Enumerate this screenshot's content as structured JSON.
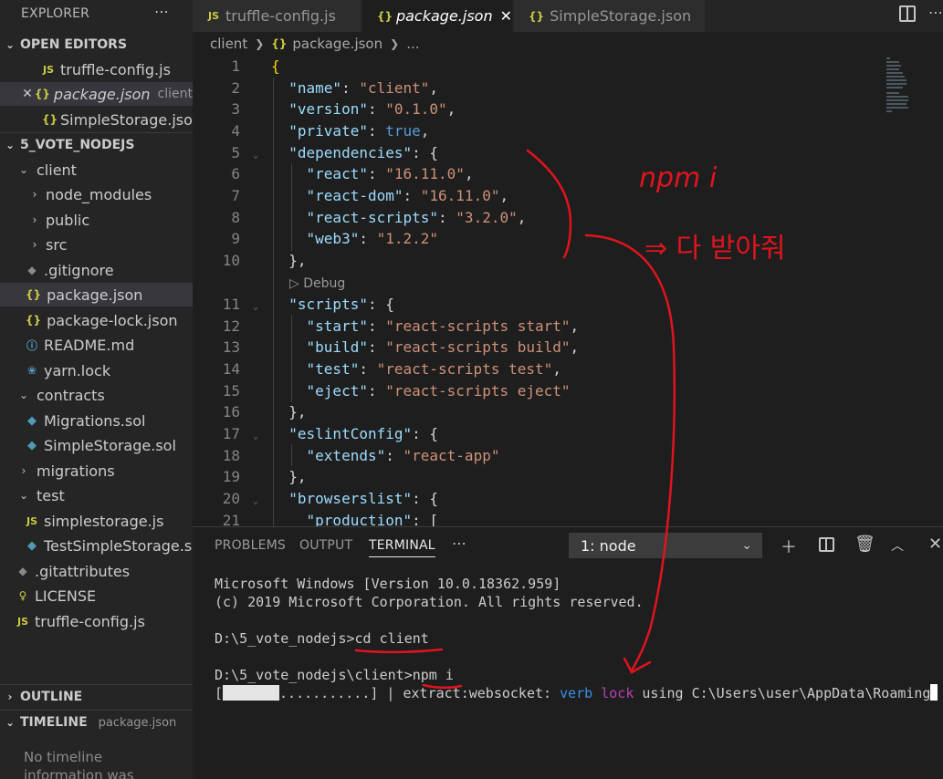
{
  "sidebar": {
    "title": "EXPLORER",
    "more": "⋯",
    "open_editors": {
      "header": "OPEN EDITORS",
      "items": [
        {
          "icon": "JS",
          "label": "truffle-config.js",
          "desc": ""
        },
        {
          "icon": "{}",
          "label": "package.json",
          "desc": "client",
          "close": "✕"
        },
        {
          "icon": "{}",
          "label": "SimpleStorage.jso...",
          "desc": ""
        }
      ]
    },
    "project": {
      "header": "5_VOTE_NODEJS",
      "items": [
        {
          "label": "client",
          "icon": ""
        },
        {
          "label": "node_modules",
          "icon": ""
        },
        {
          "label": "public",
          "icon": ""
        },
        {
          "label": "src",
          "icon": ""
        },
        {
          "label": ".gitignore",
          "icon": "◆"
        },
        {
          "label": "package.json",
          "icon": "{}"
        },
        {
          "label": "package-lock.json",
          "icon": "{}"
        },
        {
          "label": "README.md",
          "icon": "ⓘ"
        },
        {
          "label": "yarn.lock",
          "icon": "❀"
        },
        {
          "label": "contracts",
          "icon": ""
        },
        {
          "label": "Migrations.sol",
          "icon": "◆"
        },
        {
          "label": "SimpleStorage.sol",
          "icon": "◆"
        },
        {
          "label": "migrations",
          "icon": ""
        },
        {
          "label": "test",
          "icon": ""
        },
        {
          "label": "simplestorage.js",
          "icon": "JS"
        },
        {
          "label": "TestSimpleStorage.sol",
          "icon": "◆"
        },
        {
          "label": ".gitattributes",
          "icon": "◆"
        },
        {
          "label": "LICENSE",
          "icon": "♀"
        },
        {
          "label": "truffle-config.js",
          "icon": "JS"
        }
      ]
    },
    "outline": {
      "header": "OUTLINE"
    },
    "timeline": {
      "header": "TIMELINE",
      "desc": "package.json",
      "empty": "No timeline information was"
    }
  },
  "tabs": [
    {
      "icon": "JS",
      "label": "truffle-config.js"
    },
    {
      "icon": "{}",
      "label": "package.json",
      "close": "✕"
    },
    {
      "icon": "{}",
      "label": "SimpleStorage.json"
    }
  ],
  "tab_actions": {
    "more": "⋯"
  },
  "breadcrumb": {
    "folder": "client",
    "file_icon": "{}",
    "file": "package.json",
    "tail": "..."
  },
  "editor": {
    "line_numbers": [
      "1",
      "2",
      "3",
      "4",
      "5",
      "6",
      "7",
      "8",
      "9",
      "10",
      "11",
      "12",
      "13",
      "14",
      "15",
      "16",
      "17",
      "18",
      "19",
      "20",
      "21"
    ],
    "codelens": "▷ Debug",
    "code": {
      "l1": "{",
      "name_key": "\"name\"",
      "name_val": "\"client\"",
      "version_key": "\"version\"",
      "version_val": "\"0.1.0\"",
      "private_key": "\"private\"",
      "private_val": "true",
      "deps_key": "\"dependencies\"",
      "react_key": "\"react\"",
      "react_val": "\"16.11.0\"",
      "reactdom_key": "\"react-dom\"",
      "reactdom_val": "\"16.11.0\"",
      "rs_key": "\"react-scripts\"",
      "rs_val": "\"3.2.0\"",
      "web3_key": "\"web3\"",
      "web3_val": "\"1.2.2\"",
      "scripts_key": "\"scripts\"",
      "start_key": "\"start\"",
      "start_val": "\"react-scripts start\"",
      "build_key": "\"build\"",
      "build_val": "\"react-scripts build\"",
      "test_key": "\"test\"",
      "test_val": "\"react-scripts test\"",
      "eject_key": "\"eject\"",
      "eject_val": "\"react-scripts eject\"",
      "eslint_key": "\"eslintConfig\"",
      "extends_key": "\"extends\"",
      "extends_val": "\"react-app\"",
      "browsers_key": "\"browserslist\"",
      "production_key": "\"production\""
    }
  },
  "panel": {
    "tabs": [
      "PROBLEMS",
      "OUTPUT",
      "TERMINAL"
    ],
    "more": "⋯",
    "terminal_select": "1: node",
    "terminal": {
      "l1": "Microsoft Windows [Version 10.0.18362.959]",
      "l2": "(c) 2019 Microsoft Corporation. All rights reserved.",
      "l3_prompt": "D:\\5_vote_nodejs>",
      "l3_cmd": "cd client",
      "l4_prompt": "D:\\5_vote_nodejs\\client>",
      "l4_cmd": "npm i",
      "l5_open": "[",
      "l5_dots": "...........] | extract:websocket: ",
      "l5_verb": "verb",
      "l5_lock": "lock",
      "l5_rest": " using C:\\Users\\user\\AppData\\Roaming"
    }
  },
  "annotations": {
    "note1": "npm i",
    "note2": "⇒ 다 받아줘"
  },
  "colors": {
    "accent": "#007acc",
    "pen": "#e0141e"
  }
}
